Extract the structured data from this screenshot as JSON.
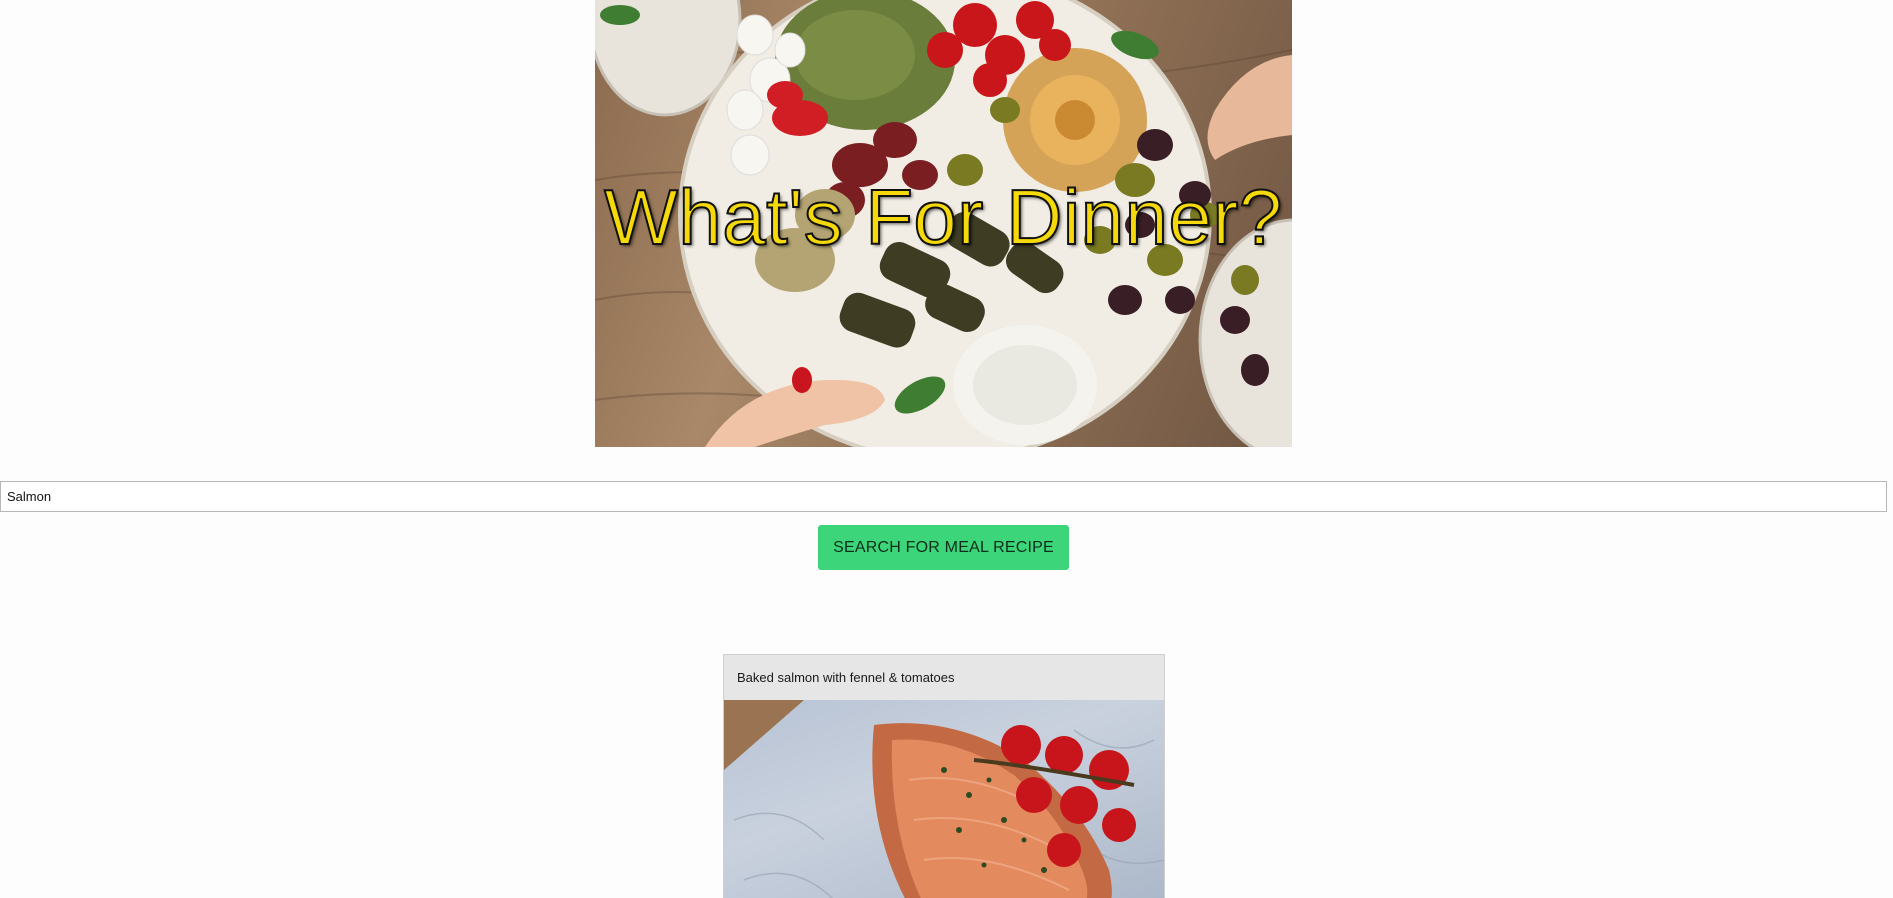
{
  "hero": {
    "title": "What's For Dinner?",
    "image": "mezze-platter-photo"
  },
  "search": {
    "value": "Salmon",
    "button_label": "SEARCH FOR MEAL RECIPE"
  },
  "results": [
    {
      "title": "Baked salmon with fennel & tomatoes",
      "image": "baked-salmon-photo"
    }
  ],
  "colors": {
    "accent_button": "#3cd57a",
    "title_text": "#f5d90a",
    "card_header": "#e6e6e6"
  }
}
